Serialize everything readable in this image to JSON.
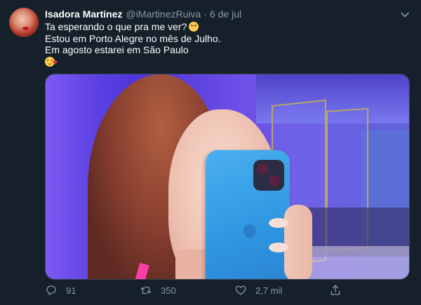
{
  "tweet": {
    "author_name": "Isadora Martinez",
    "handle": "@iMartinezRuiva",
    "separator": "·",
    "date": "6 de jul",
    "lines": [
      "Ta esperando o que pra me ver?",
      "Estou em Porto Alegre no mês de Julho.",
      "Em agosto estarei em São Paulo"
    ],
    "line_emojis": [
      "upside-down-face",
      "face-blowing-a-kiss"
    ]
  },
  "actions": {
    "replies": "91",
    "retweets": "350",
    "likes": "2,7 mil"
  },
  "icons": {
    "menu": "chevron-down-icon",
    "reply": "reply-icon",
    "retweet": "retweet-icon",
    "like": "heart-icon",
    "share": "share-icon"
  },
  "colors": {
    "background": "#15202b",
    "secondary_text": "#8899a6",
    "primary_text": "#ffffff"
  }
}
